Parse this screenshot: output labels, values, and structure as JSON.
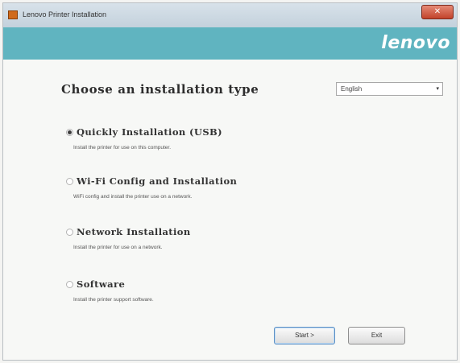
{
  "window": {
    "title": "Lenovo Printer Installation",
    "close_label": "✕"
  },
  "banner": {
    "brand": "lenovo"
  },
  "main": {
    "heading": "Choose an installation type",
    "language": {
      "selected": "English",
      "arrow": "▾"
    },
    "options": [
      {
        "label": "Quickly Installation (USB)",
        "description": "Install the printer for use on this computer.",
        "selected": true
      },
      {
        "label": "Wi-Fi Config and Installation",
        "description": "WiFi config and install the printer use on a network.",
        "selected": false
      },
      {
        "label": "Network Installation",
        "description": "Install the printer for use on a network.",
        "selected": false
      },
      {
        "label": "Software",
        "description": "Install the printer support software.",
        "selected": false
      }
    ]
  },
  "footer": {
    "start_label": "Start >",
    "exit_label": "Exit"
  },
  "colors": {
    "banner": "#60b4c0",
    "window_bg": "#f7f8f6"
  }
}
